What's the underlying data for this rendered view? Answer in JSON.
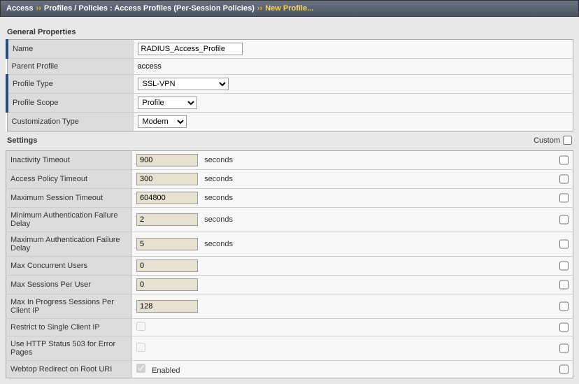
{
  "breadcrumb": {
    "root": "Access",
    "middle": "Profiles / Policies : Access Profiles (Per-Session Policies)",
    "last": "New Profile..."
  },
  "sections": {
    "general": {
      "title": "General Properties"
    },
    "settings": {
      "title": "Settings",
      "customLabel": "Custom"
    }
  },
  "general": {
    "nameLabel": "Name",
    "nameValue": "RADIUS_Access_Profile",
    "parentProfileLabel": "Parent Profile",
    "parentProfileValue": "access",
    "profileTypeLabel": "Profile Type",
    "profileTypeValue": "SSL-VPN",
    "profileScopeLabel": "Profile Scope",
    "profileScopeValue": "Profile",
    "customTypeLabel": "Customization Type",
    "customTypeValue": "Modern"
  },
  "settings": {
    "inactivityTimeoutLabel": "Inactivity Timeout",
    "inactivityTimeoutValue": "900",
    "accessPolicyTimeoutLabel": "Access Policy Timeout",
    "accessPolicyTimeoutValue": "300",
    "maxSessionTimeoutLabel": "Maximum Session Timeout",
    "maxSessionTimeoutValue": "604800",
    "minAuthFailDelayLabel": "Minimum Authentication Failure Delay",
    "minAuthFailDelayValue": "2",
    "maxAuthFailDelayLabel": "Maximum Authentication Failure Delay",
    "maxAuthFailDelayValue": "5",
    "maxConcurrentUsersLabel": "Max Concurrent Users",
    "maxConcurrentUsersValue": "0",
    "maxSessionsPerUserLabel": "Max Sessions Per User",
    "maxSessionsPerUserValue": "0",
    "maxInProgressLabel": "Max In Progress Sessions Per Client IP",
    "maxInProgressValue": "128",
    "restrictSingleIPLabel": "Restrict to Single Client IP",
    "useHttp503Label": "Use HTTP Status 503 for Error Pages",
    "webtopRedirectLabel": "Webtop Redirect on Root URI",
    "enabledText": "Enabled",
    "secondsText": "seconds"
  }
}
